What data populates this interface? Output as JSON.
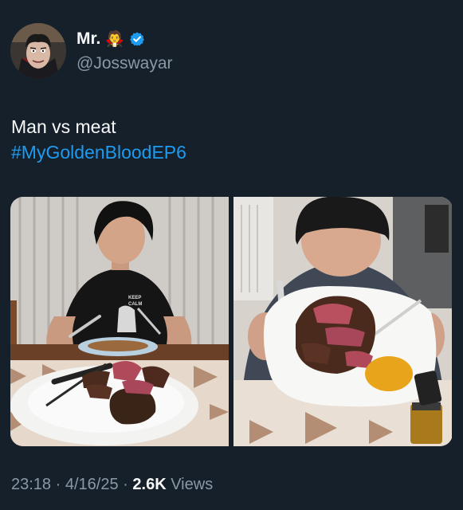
{
  "author": {
    "display_name": "Mr.",
    "emoji": "🧛",
    "handle": "@Josswayar",
    "verified": true,
    "avatar_icon": "cartoon-vampire-avatar"
  },
  "tweet": {
    "line1": "Man vs meat",
    "hashtag": "#MyGoldenBloodEP6"
  },
  "media": [
    {
      "label": "photo-seated-with-steak-plate",
      "shirt_text_line1": "KEEP",
      "shirt_text_line2": "CALM"
    },
    {
      "label": "photo-close-up-eating-steak"
    }
  ],
  "meta": {
    "time": "23:18",
    "separator": "·",
    "date": "4/16/25",
    "views_count": "2.6K",
    "views_label": "Views"
  },
  "colors": {
    "background": "#15202b",
    "hashtag": "#1d9bf0",
    "secondary_text": "#8b98a5",
    "verified_badge": "#1d9bf0"
  }
}
